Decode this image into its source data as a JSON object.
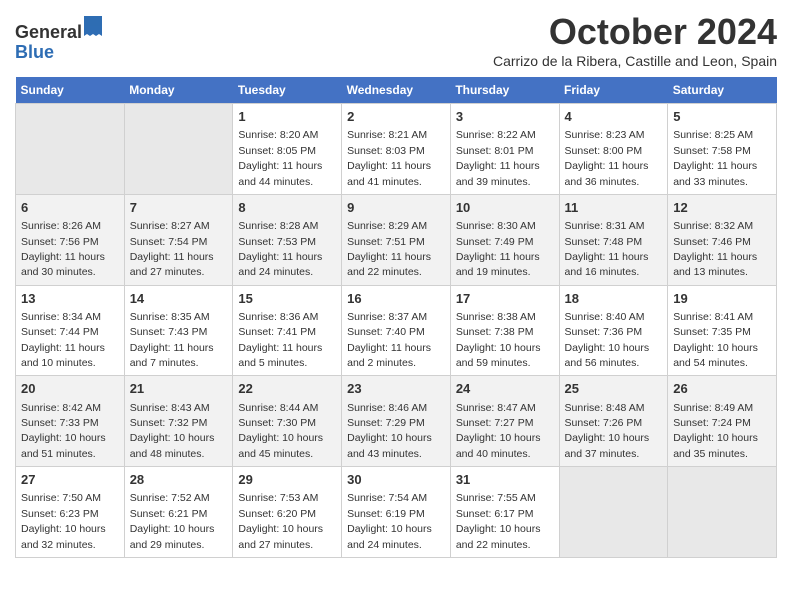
{
  "header": {
    "logo_general": "General",
    "logo_blue": "Blue",
    "main_title": "October 2024",
    "subtitle": "Carrizo de la Ribera, Castille and Leon, Spain"
  },
  "days_of_week": [
    "Sunday",
    "Monday",
    "Tuesday",
    "Wednesday",
    "Thursday",
    "Friday",
    "Saturday"
  ],
  "weeks": [
    [
      {
        "day": "",
        "empty": true
      },
      {
        "day": "",
        "empty": true
      },
      {
        "day": "1",
        "sunrise": "Sunrise: 8:20 AM",
        "sunset": "Sunset: 8:05 PM",
        "daylight": "Daylight: 11 hours and 44 minutes."
      },
      {
        "day": "2",
        "sunrise": "Sunrise: 8:21 AM",
        "sunset": "Sunset: 8:03 PM",
        "daylight": "Daylight: 11 hours and 41 minutes."
      },
      {
        "day": "3",
        "sunrise": "Sunrise: 8:22 AM",
        "sunset": "Sunset: 8:01 PM",
        "daylight": "Daylight: 11 hours and 39 minutes."
      },
      {
        "day": "4",
        "sunrise": "Sunrise: 8:23 AM",
        "sunset": "Sunset: 8:00 PM",
        "daylight": "Daylight: 11 hours and 36 minutes."
      },
      {
        "day": "5",
        "sunrise": "Sunrise: 8:25 AM",
        "sunset": "Sunset: 7:58 PM",
        "daylight": "Daylight: 11 hours and 33 minutes."
      }
    ],
    [
      {
        "day": "6",
        "sunrise": "Sunrise: 8:26 AM",
        "sunset": "Sunset: 7:56 PM",
        "daylight": "Daylight: 11 hours and 30 minutes."
      },
      {
        "day": "7",
        "sunrise": "Sunrise: 8:27 AM",
        "sunset": "Sunset: 7:54 PM",
        "daylight": "Daylight: 11 hours and 27 minutes."
      },
      {
        "day": "8",
        "sunrise": "Sunrise: 8:28 AM",
        "sunset": "Sunset: 7:53 PM",
        "daylight": "Daylight: 11 hours and 24 minutes."
      },
      {
        "day": "9",
        "sunrise": "Sunrise: 8:29 AM",
        "sunset": "Sunset: 7:51 PM",
        "daylight": "Daylight: 11 hours and 22 minutes."
      },
      {
        "day": "10",
        "sunrise": "Sunrise: 8:30 AM",
        "sunset": "Sunset: 7:49 PM",
        "daylight": "Daylight: 11 hours and 19 minutes."
      },
      {
        "day": "11",
        "sunrise": "Sunrise: 8:31 AM",
        "sunset": "Sunset: 7:48 PM",
        "daylight": "Daylight: 11 hours and 16 minutes."
      },
      {
        "day": "12",
        "sunrise": "Sunrise: 8:32 AM",
        "sunset": "Sunset: 7:46 PM",
        "daylight": "Daylight: 11 hours and 13 minutes."
      }
    ],
    [
      {
        "day": "13",
        "sunrise": "Sunrise: 8:34 AM",
        "sunset": "Sunset: 7:44 PM",
        "daylight": "Daylight: 11 hours and 10 minutes."
      },
      {
        "day": "14",
        "sunrise": "Sunrise: 8:35 AM",
        "sunset": "Sunset: 7:43 PM",
        "daylight": "Daylight: 11 hours and 7 minutes."
      },
      {
        "day": "15",
        "sunrise": "Sunrise: 8:36 AM",
        "sunset": "Sunset: 7:41 PM",
        "daylight": "Daylight: 11 hours and 5 minutes."
      },
      {
        "day": "16",
        "sunrise": "Sunrise: 8:37 AM",
        "sunset": "Sunset: 7:40 PM",
        "daylight": "Daylight: 11 hours and 2 minutes."
      },
      {
        "day": "17",
        "sunrise": "Sunrise: 8:38 AM",
        "sunset": "Sunset: 7:38 PM",
        "daylight": "Daylight: 10 hours and 59 minutes."
      },
      {
        "day": "18",
        "sunrise": "Sunrise: 8:40 AM",
        "sunset": "Sunset: 7:36 PM",
        "daylight": "Daylight: 10 hours and 56 minutes."
      },
      {
        "day": "19",
        "sunrise": "Sunrise: 8:41 AM",
        "sunset": "Sunset: 7:35 PM",
        "daylight": "Daylight: 10 hours and 54 minutes."
      }
    ],
    [
      {
        "day": "20",
        "sunrise": "Sunrise: 8:42 AM",
        "sunset": "Sunset: 7:33 PM",
        "daylight": "Daylight: 10 hours and 51 minutes."
      },
      {
        "day": "21",
        "sunrise": "Sunrise: 8:43 AM",
        "sunset": "Sunset: 7:32 PM",
        "daylight": "Daylight: 10 hours and 48 minutes."
      },
      {
        "day": "22",
        "sunrise": "Sunrise: 8:44 AM",
        "sunset": "Sunset: 7:30 PM",
        "daylight": "Daylight: 10 hours and 45 minutes."
      },
      {
        "day": "23",
        "sunrise": "Sunrise: 8:46 AM",
        "sunset": "Sunset: 7:29 PM",
        "daylight": "Daylight: 10 hours and 43 minutes."
      },
      {
        "day": "24",
        "sunrise": "Sunrise: 8:47 AM",
        "sunset": "Sunset: 7:27 PM",
        "daylight": "Daylight: 10 hours and 40 minutes."
      },
      {
        "day": "25",
        "sunrise": "Sunrise: 8:48 AM",
        "sunset": "Sunset: 7:26 PM",
        "daylight": "Daylight: 10 hours and 37 minutes."
      },
      {
        "day": "26",
        "sunrise": "Sunrise: 8:49 AM",
        "sunset": "Sunset: 7:24 PM",
        "daylight": "Daylight: 10 hours and 35 minutes."
      }
    ],
    [
      {
        "day": "27",
        "sunrise": "Sunrise: 7:50 AM",
        "sunset": "Sunset: 6:23 PM",
        "daylight": "Daylight: 10 hours and 32 minutes."
      },
      {
        "day": "28",
        "sunrise": "Sunrise: 7:52 AM",
        "sunset": "Sunset: 6:21 PM",
        "daylight": "Daylight: 10 hours and 29 minutes."
      },
      {
        "day": "29",
        "sunrise": "Sunrise: 7:53 AM",
        "sunset": "Sunset: 6:20 PM",
        "daylight": "Daylight: 10 hours and 27 minutes."
      },
      {
        "day": "30",
        "sunrise": "Sunrise: 7:54 AM",
        "sunset": "Sunset: 6:19 PM",
        "daylight": "Daylight: 10 hours and 24 minutes."
      },
      {
        "day": "31",
        "sunrise": "Sunrise: 7:55 AM",
        "sunset": "Sunset: 6:17 PM",
        "daylight": "Daylight: 10 hours and 22 minutes."
      },
      {
        "day": "",
        "empty": true
      },
      {
        "day": "",
        "empty": true
      }
    ]
  ]
}
